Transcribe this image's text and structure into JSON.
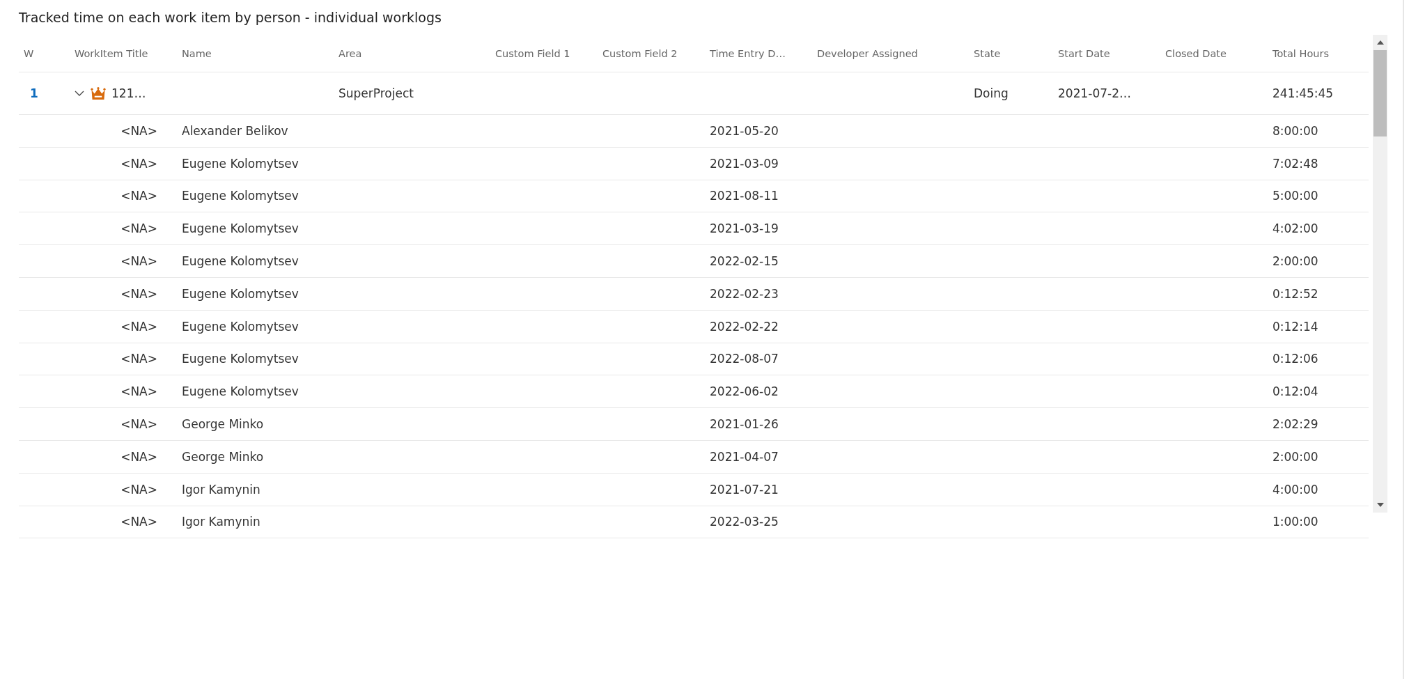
{
  "title": "Tracked time on each work item by person - individual worklogs",
  "table": {
    "columns": [
      "W",
      "WorkItem Title",
      "Name",
      "Area",
      "Custom Field 1",
      "Custom Field 2",
      "Time Entry D…",
      "Developer Assigned",
      "State",
      "Start Date",
      "Closed Date",
      "Total Hours"
    ],
    "rows": [
      {
        "index": "1",
        "expanded": true,
        "title": "121…",
        "area": "SuperProject",
        "state": "Doing",
        "start_date": "2021-07-2…",
        "total_hours": "241:45:45",
        "children": [
          {
            "title": "<NA>",
            "name": "Alexander Belikov",
            "time_entry_date": "2021-05-20",
            "total_hours": "8:00:00"
          },
          {
            "title": "<NA>",
            "name": "Eugene Kolomytsev",
            "time_entry_date": "2021-03-09",
            "total_hours": "7:02:48"
          },
          {
            "title": "<NA>",
            "name": "Eugene Kolomytsev",
            "time_entry_date": "2021-08-11",
            "total_hours": "5:00:00"
          },
          {
            "title": "<NA>",
            "name": "Eugene Kolomytsev",
            "time_entry_date": "2021-03-19",
            "total_hours": "4:02:00"
          },
          {
            "title": "<NA>",
            "name": "Eugene Kolomytsev",
            "time_entry_date": "2022-02-15",
            "total_hours": "2:00:00"
          },
          {
            "title": "<NA>",
            "name": "Eugene Kolomytsev",
            "time_entry_date": "2022-02-23",
            "total_hours": "0:12:52"
          },
          {
            "title": "<NA>",
            "name": "Eugene Kolomytsev",
            "time_entry_date": "2022-02-22",
            "total_hours": "0:12:14"
          },
          {
            "title": "<NA>",
            "name": "Eugene Kolomytsev",
            "time_entry_date": "2022-08-07",
            "total_hours": "0:12:06"
          },
          {
            "title": "<NA>",
            "name": "Eugene Kolomytsev",
            "time_entry_date": "2022-06-02",
            "total_hours": "0:12:04"
          },
          {
            "title": "<NA>",
            "name": "George Minko",
            "time_entry_date": "2021-01-26",
            "total_hours": "2:02:29"
          },
          {
            "title": "<NA>",
            "name": "George Minko",
            "time_entry_date": "2021-04-07",
            "total_hours": "2:00:00"
          },
          {
            "title": "<NA>",
            "name": "Igor Kamynin",
            "time_entry_date": "2021-07-21",
            "total_hours": "4:00:00"
          },
          {
            "title": "<NA>",
            "name": "Igor Kamynin",
            "time_entry_date": "2022-03-25",
            "total_hours": "1:00:00"
          }
        ]
      }
    ]
  }
}
